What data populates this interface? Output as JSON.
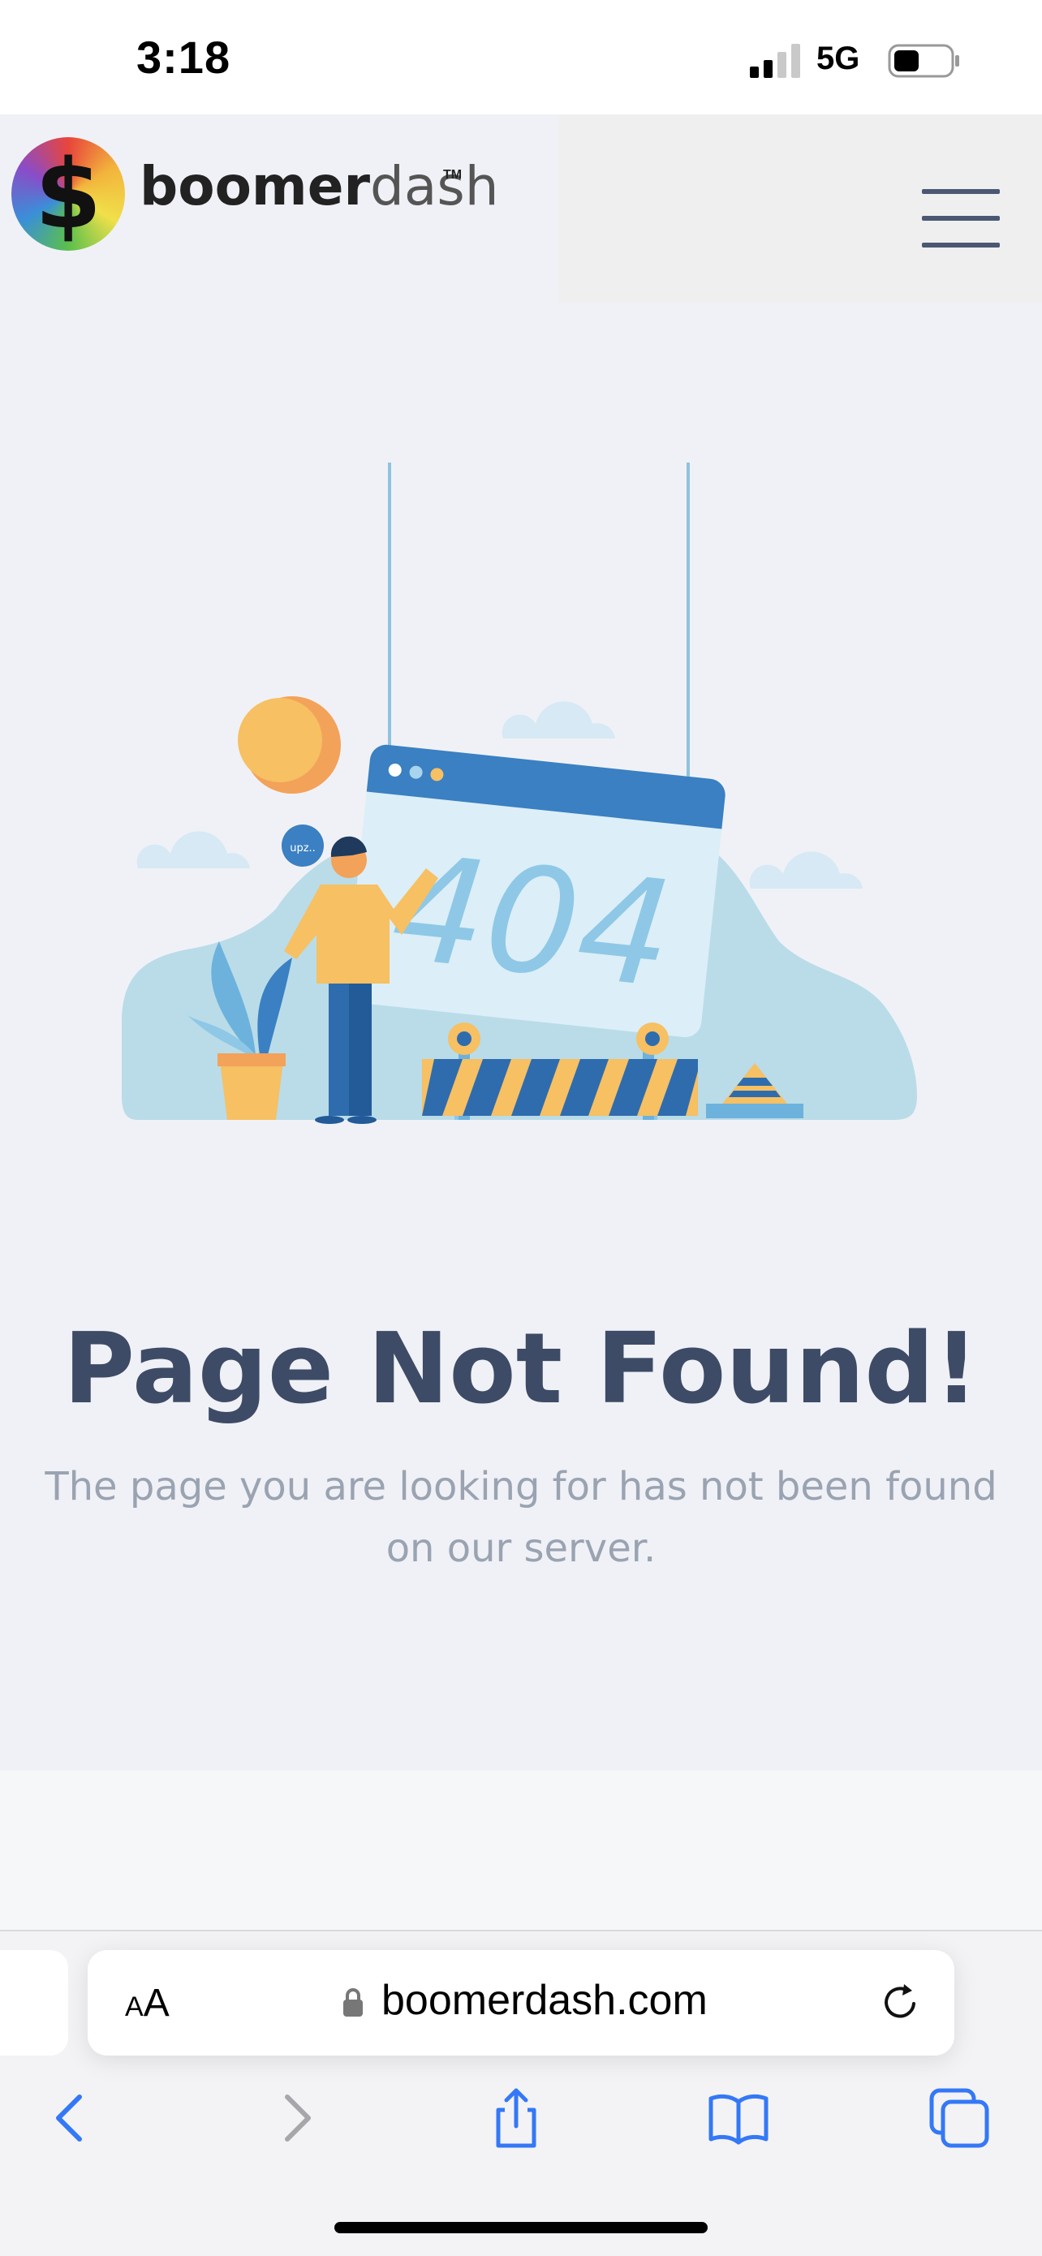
{
  "status_bar": {
    "time": "3:18",
    "network": "5G",
    "icons": [
      "signal-icon",
      "battery-icon"
    ]
  },
  "header": {
    "logo_symbol": "$",
    "brand_bold": "boomer",
    "brand_light": "dash",
    "trademark": "TM",
    "menu_icon": "hamburger-menu-icon"
  },
  "illustration": {
    "sign_text": "404",
    "speech_bubble": "upz.."
  },
  "main": {
    "title": "Page Not Found!",
    "description": "The page you are looking for has not been found on our server."
  },
  "browser": {
    "text_size_small": "A",
    "text_size_large": "A",
    "url": "boomerdash.com",
    "toolbar_icons": [
      "back-icon",
      "forward-icon",
      "share-icon",
      "bookmarks-icon",
      "tabs-icon"
    ]
  },
  "colors": {
    "title": "#3d4b66",
    "description": "#9aa3b1",
    "accent_blue": "#3a80c2",
    "ios_blue": "#3478f6"
  }
}
